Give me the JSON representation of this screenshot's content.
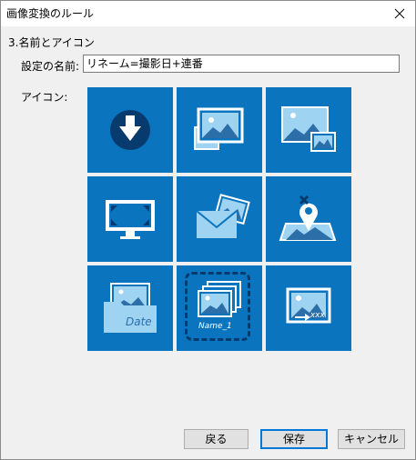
{
  "window": {
    "title": "画像変換のルール"
  },
  "section": {
    "title": "3.名前とアイコン"
  },
  "name_field": {
    "label": "設定の名前:",
    "value": "リネーム=撮影日+連番"
  },
  "icons": {
    "label": "アイコン:",
    "date_text": "Date",
    "name_text": "Name_1",
    "ext_text": ".xxx"
  },
  "buttons": {
    "back": "戻る",
    "save": "保存",
    "cancel": "キャンセル"
  },
  "colors": {
    "tile": "#0a74bf",
    "selection": "#073b6d"
  }
}
